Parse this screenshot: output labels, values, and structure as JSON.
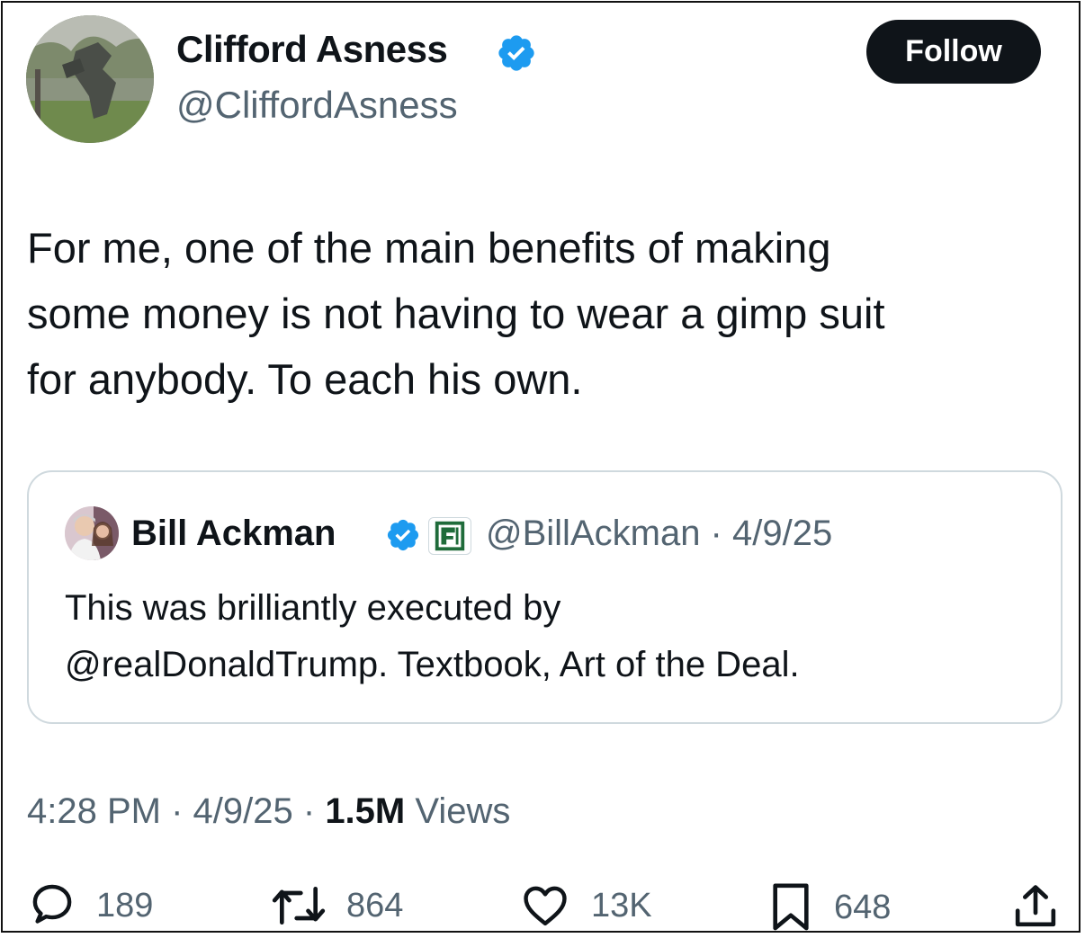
{
  "author": {
    "display_name": "Clifford Asness",
    "handle": "@CliffordAsness",
    "verified": true
  },
  "follow_label": "Follow",
  "tweet_text_lines": [
    "For me, one of the main benefits of making",
    "some money is not having to wear a gimp suit",
    "for anybody. To each his own."
  ],
  "quoted_tweet": {
    "display_name": "Bill Ackman",
    "handle_date": "@BillAckman · 4/9/25",
    "verified": true,
    "text_lines": [
      "This was brilliantly executed by",
      "@realDonaldTrump. Textbook, Art of the Deal."
    ]
  },
  "meta": {
    "time": "4:28 PM",
    "date": "4/9/25",
    "views_count": "1.5M",
    "views_label": "Views"
  },
  "actions": {
    "replies": "189",
    "reposts": "864",
    "likes": "13K",
    "bookmarks": "648"
  },
  "colors": {
    "verified_blue": "#1d9bf0",
    "text_primary": "#0f1419",
    "text_secondary": "#536471",
    "border": "#cfd9de"
  }
}
